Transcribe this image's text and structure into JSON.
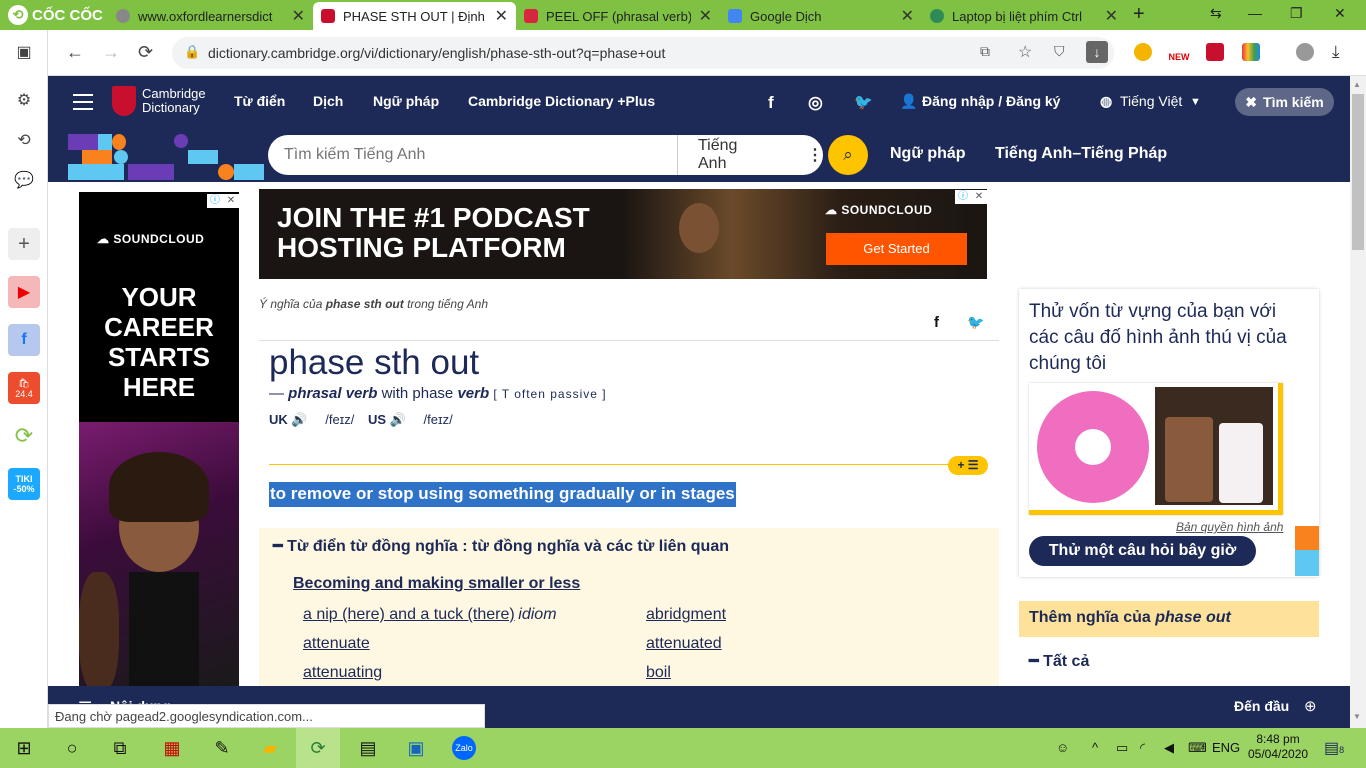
{
  "browser": {
    "name": "CỐC CỐC",
    "tabs": [
      {
        "title": "www.oxfordlearnersdict",
        "favicon_color": "#888888"
      },
      {
        "title": "PHASE STH OUT | Định",
        "favicon_color": "#c8102e"
      },
      {
        "title": "PEEL OFF (phrasal verb)",
        "favicon_color": "#d7263d"
      },
      {
        "title": "Google Dịch",
        "favicon_color": "#4285f4"
      },
      {
        "title": "Laptop bị liệt phím Ctrl",
        "favicon_color": "#2e8b57"
      }
    ],
    "url": "dictionary.cambridge.org/vi/dictionary/english/phase-sth-out?q=phase+out",
    "status": "Đang chờ pagead2.googlesyndication.com...",
    "badge_new": "NEW",
    "sidebar_badges": {
      "shopee": "24.4",
      "tiki_top": "TIKI",
      "tiki_bottom": "-50%"
    }
  },
  "site": {
    "logo_line1": "Cambridge",
    "logo_line2": "Dictionary",
    "nav": [
      "Từ điển",
      "Dịch",
      "Ngữ pháp",
      "Cambridge Dictionary +Plus"
    ],
    "login": "Đăng nhập / Đăng ký",
    "language": "Tiếng Việt",
    "search_button": "Tìm kiếm",
    "search_placeholder": "Tìm kiếm Tiếng Anh",
    "dictionary_select": "Tiếng Anh",
    "links": [
      "Ngữ pháp",
      "Tiếng Anh–Tiếng Pháp"
    ]
  },
  "ads": {
    "left_brand": "SOUNDCLOUD",
    "left_headline": "YOUR CAREER STARTS HERE",
    "top_headline_1": "JOIN THE #1 PODCAST",
    "top_headline_2": "HOSTING PLATFORM",
    "top_brand": "SOUNDCLOUD",
    "top_cta": "Get Started"
  },
  "entry": {
    "breadcrumb_pre": "Ý nghĩa của ",
    "breadcrumb_word": "phase sth out",
    "breadcrumb_post": " trong tiếng Anh",
    "headword": "phase sth out",
    "pos": "phrasal verb",
    "with": "with phase",
    "pos2": "verb",
    "grammar": "[ T often passive ]",
    "uk_label": "UK",
    "us_label": "US",
    "uk_ipa": "/feɪz/",
    "us_ipa": "/feɪz/",
    "definition": "to remove or stop using something gradually or in stages",
    "badge": "+ ☰"
  },
  "thesaurus": {
    "heading": "Từ điển từ đồng nghĩa : từ đồng nghĩa và các từ liên quan",
    "subheading": "Becoming and making smaller or less",
    "left_items": [
      "a nip (here) and a tuck (there)",
      "attenuate",
      "attenuating"
    ],
    "left_item0_tag": "idiom",
    "right_items": [
      "abridgment",
      "attenuated",
      "boil"
    ]
  },
  "right_panel": {
    "quiz_text": "Thử vốn từ vựng của bạn với các câu đố hình ảnh thú vị của chúng tôi",
    "credit": "Bản quyền hình ảnh",
    "quiz_button": "Thử một câu hỏi bây giờ",
    "more_label": "Thêm nghĩa của",
    "more_word": "phase out",
    "all_label": "Tất cả"
  },
  "footer": {
    "nav_label": "Nội dung",
    "top_label": "Đến đầu"
  },
  "taskbar": {
    "lang": "ENG",
    "time": "8:48 pm",
    "date": "05/04/2020",
    "notif_count": "8"
  }
}
